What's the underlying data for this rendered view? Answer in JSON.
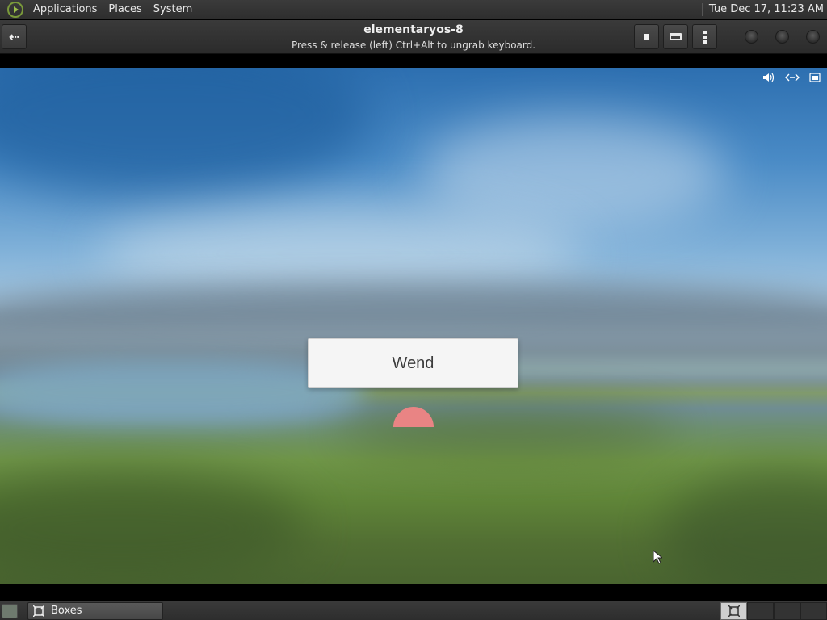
{
  "top_panel": {
    "menus": [
      "Applications",
      "Places",
      "System"
    ],
    "clock": "Tue Dec 17, 11:23 AM"
  },
  "header": {
    "title": "elementaryos-8",
    "subtitle": "Press & release (left) Ctrl+Alt to ungrab keyboard.",
    "back_icon": "back-arrow-icon",
    "buttons": [
      "stop-icon",
      "keyboard-icon",
      "menu-dots-icon"
    ],
    "window_controls": [
      "minimize",
      "maximize",
      "close"
    ]
  },
  "vm": {
    "tray_icons": [
      "volume-icon",
      "network-icon",
      "keyboard-layout-icon"
    ],
    "login_user": "Wend"
  },
  "taskbar": {
    "task_label": "Boxes",
    "workspaces": 4,
    "active_workspace": 1
  },
  "colors": {
    "panel_bg": "#2e2e2e",
    "avatar": "#e98484",
    "card_bg": "#f5f5f5"
  }
}
